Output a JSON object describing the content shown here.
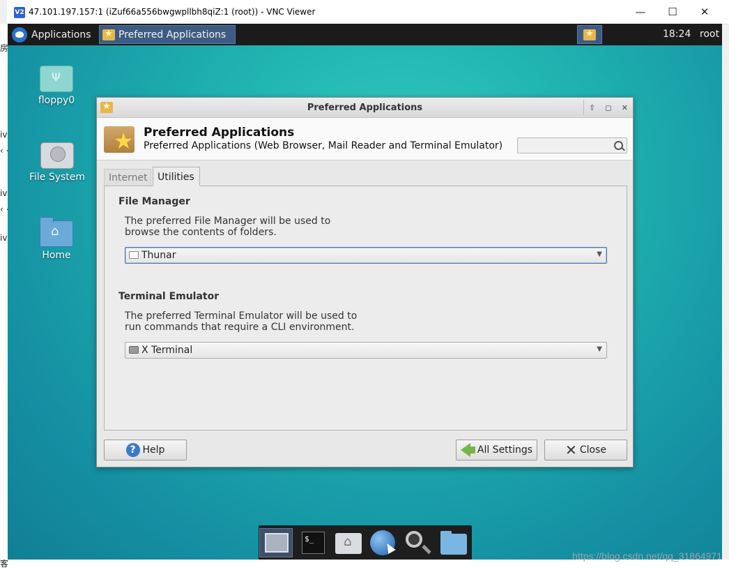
{
  "vnc": {
    "title": "47.101.197.157:1 (iZuf66a556bwgwpllbh8qiZ:1 (root)) - VNC Viewer",
    "logo_text": "V2",
    "minimize": "—",
    "maximize": "☐",
    "close": "✕"
  },
  "host_fragments": [
    "房",
    "iv",
    "‹ <",
    "iv",
    "‹ <",
    "iv",
    "客服"
  ],
  "watermark": "https://blog.csdn.net/qq_31864971",
  "panel": {
    "applications_label": "Applications",
    "task_label": "Preferred Applications",
    "clock": "18:24",
    "user": "root"
  },
  "desktop_icons": [
    {
      "label": "floppy0",
      "icon": "usb-drive-icon"
    },
    {
      "label": "File System",
      "icon": "hard-disk-icon"
    },
    {
      "label": "Home",
      "icon": "home-folder-icon"
    }
  ],
  "dialog": {
    "window_title": "Preferred Applications",
    "window_buttons": [
      "⇧",
      "◻",
      "✕"
    ],
    "header_title": "Preferred Applications",
    "header_subtitle": "Preferred Applications (Web Browser, Mail Reader and Terminal Emulator)",
    "search_placeholder": "",
    "tabs": [
      {
        "label": "Internet",
        "active": false
      },
      {
        "label": "Utilities",
        "active": true
      }
    ],
    "file_manager": {
      "title": "File Manager",
      "description": "The preferred File Manager will be used to\nbrowse the contents of folders.",
      "selected": "Thunar"
    },
    "terminal": {
      "title": "Terminal Emulator",
      "description": "The preferred Terminal Emulator will be used to\nrun commands that require a CLI environment.",
      "selected": "X Terminal"
    },
    "buttons": {
      "help": "Help",
      "all_settings": "All Settings",
      "close": "Close"
    }
  },
  "dock": {
    "items": [
      "show-desktop",
      "terminal",
      "home-folder",
      "web-browser",
      "app-finder",
      "file-manager"
    ],
    "terminal_prompt": "$_"
  },
  "colors": {
    "panel_bg": "#1b1b1b",
    "task_active": "#3d5b83",
    "desktop_teal": "#1fb3b0",
    "focus_blue": "#4a79b3"
  }
}
